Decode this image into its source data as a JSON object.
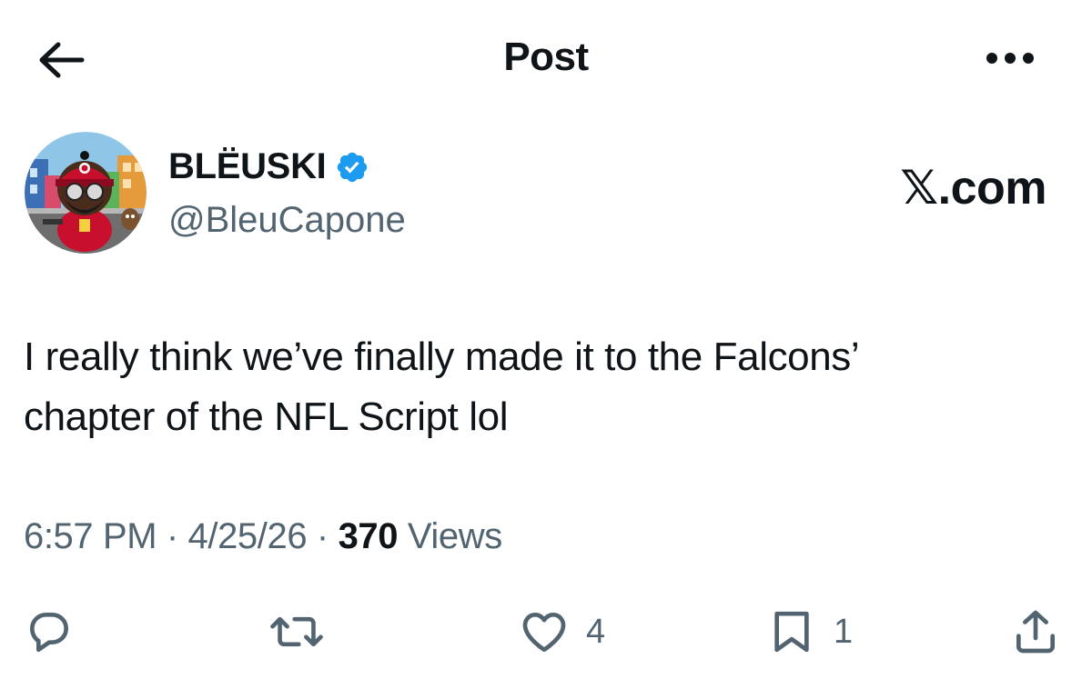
{
  "header": {
    "title": "Post",
    "back_icon": "arrow-left-icon",
    "more_icon": "more-horizontal-icon"
  },
  "author": {
    "display_name": "BLËUSKI",
    "handle": "@BleuCapone",
    "verified_icon": "verified-badge-icon",
    "verified_color": "#1d9bf0"
  },
  "watermark": "𝕏.com",
  "tweet": {
    "text_line1": "I really think we’ve finally made it to the Falcons’",
    "text_line2": "chapter of the NFL Script lol"
  },
  "meta": {
    "time": "6:57 PM",
    "sep1": " · ",
    "date": "4/25/26",
    "sep2": " · ",
    "views_count": "370",
    "views_label": " Views"
  },
  "actions": {
    "reply": {
      "icon": "reply-icon",
      "count": ""
    },
    "repost": {
      "icon": "repost-icon",
      "count": ""
    },
    "like": {
      "icon": "heart-icon",
      "count": "4"
    },
    "bookmark": {
      "icon": "bookmark-icon",
      "count": "1"
    },
    "share": {
      "icon": "share-icon",
      "count": ""
    }
  },
  "colors": {
    "text_primary": "#0f1419",
    "text_secondary": "#536471",
    "background": "#ffffff"
  }
}
